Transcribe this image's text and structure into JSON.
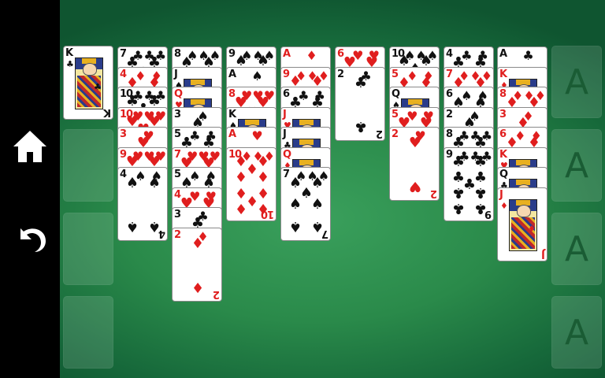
{
  "controls": {
    "home_icon": "home-icon",
    "undo_icon": "undo-icon"
  },
  "foundations": [
    {
      "label": "A"
    },
    {
      "label": "A"
    },
    {
      "label": "A"
    },
    {
      "label": "A"
    }
  ],
  "freecells": [
    {
      "card": {
        "rank": "K",
        "suit": "clubs",
        "face": true
      }
    },
    {
      "card": null
    },
    {
      "card": null
    },
    {
      "card": null
    }
  ],
  "tableau": [
    [
      {
        "rank": "7",
        "suit": "clubs"
      },
      {
        "rank": "4",
        "suit": "diamonds"
      },
      {
        "rank": "10",
        "suit": "clubs"
      },
      {
        "rank": "10",
        "suit": "hearts"
      },
      {
        "rank": "3",
        "suit": "hearts"
      },
      {
        "rank": "9",
        "suit": "hearts"
      },
      {
        "rank": "4",
        "suit": "spades"
      }
    ],
    [
      {
        "rank": "8",
        "suit": "spades"
      },
      {
        "rank": "J",
        "suit": "spades",
        "face": true
      },
      {
        "rank": "Q",
        "suit": "hearts",
        "face": true
      },
      {
        "rank": "3",
        "suit": "spades"
      },
      {
        "rank": "5",
        "suit": "clubs"
      },
      {
        "rank": "7",
        "suit": "hearts"
      },
      {
        "rank": "5",
        "suit": "spades"
      },
      {
        "rank": "4",
        "suit": "hearts"
      },
      {
        "rank": "3",
        "suit": "clubs"
      },
      {
        "rank": "2",
        "suit": "diamonds"
      }
    ],
    [
      {
        "rank": "9",
        "suit": "spades"
      },
      {
        "rank": "A",
        "suit": "spades"
      },
      {
        "rank": "8",
        "suit": "hearts"
      },
      {
        "rank": "K",
        "suit": "spades",
        "face": true
      },
      {
        "rank": "A",
        "suit": "hearts"
      },
      {
        "rank": "10",
        "suit": "diamonds"
      }
    ],
    [
      {
        "rank": "A",
        "suit": "diamonds"
      },
      {
        "rank": "9",
        "suit": "diamonds"
      },
      {
        "rank": "6",
        "suit": "clubs"
      },
      {
        "rank": "J",
        "suit": "hearts",
        "face": true
      },
      {
        "rank": "J",
        "suit": "clubs",
        "face": true
      },
      {
        "rank": "Q",
        "suit": "diamonds",
        "face": true
      },
      {
        "rank": "7",
        "suit": "spades"
      }
    ],
    [
      {
        "rank": "6",
        "suit": "hearts"
      },
      {
        "rank": "2",
        "suit": "clubs"
      }
    ],
    [
      {
        "rank": "10",
        "suit": "spades"
      },
      {
        "rank": "5",
        "suit": "diamonds"
      },
      {
        "rank": "Q",
        "suit": "spades",
        "face": true
      },
      {
        "rank": "5",
        "suit": "hearts"
      },
      {
        "rank": "2",
        "suit": "hearts"
      }
    ],
    [
      {
        "rank": "4",
        "suit": "clubs"
      },
      {
        "rank": "7",
        "suit": "diamonds"
      },
      {
        "rank": "6",
        "suit": "spades"
      },
      {
        "rank": "2",
        "suit": "spades"
      },
      {
        "rank": "8",
        "suit": "clubs"
      },
      {
        "rank": "9",
        "suit": "clubs"
      }
    ],
    [
      {
        "rank": "A",
        "suit": "clubs"
      },
      {
        "rank": "K",
        "suit": "diamonds",
        "face": true
      },
      {
        "rank": "8",
        "suit": "diamonds"
      },
      {
        "rank": "3",
        "suit": "diamonds"
      },
      {
        "rank": "6",
        "suit": "diamonds"
      },
      {
        "rank": "K",
        "suit": "hearts",
        "face": true
      },
      {
        "rank": "Q",
        "suit": "clubs",
        "face": true
      },
      {
        "rank": "J",
        "suit": "diamonds",
        "face": true
      }
    ]
  ],
  "colors": {
    "table_green": "#2a8a4a",
    "red_suit": "#e01e1e",
    "black_suit": "#111111",
    "slot_letter": "#1a5c34"
  }
}
